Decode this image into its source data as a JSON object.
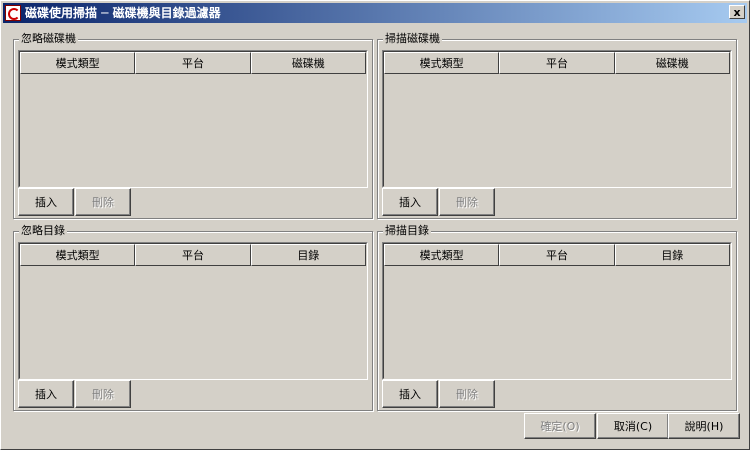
{
  "window": {
    "title": "磁碟使用掃描 ─ 磁碟機與目錄過濾器",
    "close_glyph": "x"
  },
  "panels": [
    {
      "label": "忽略磁碟機",
      "columns": [
        "模式類型",
        "平台",
        "磁碟機"
      ],
      "rows": [],
      "insert_label": "插入",
      "delete_label": "刪除"
    },
    {
      "label": "掃描磁碟機",
      "columns": [
        "模式類型",
        "平台",
        "磁碟機"
      ],
      "rows": [],
      "insert_label": "插入",
      "delete_label": "刪除"
    },
    {
      "label": "忽略目錄",
      "columns": [
        "模式類型",
        "平台",
        "目錄"
      ],
      "rows": [],
      "insert_label": "插入",
      "delete_label": "刪除"
    },
    {
      "label": "掃描目錄",
      "columns": [
        "模式類型",
        "平台",
        "目錄"
      ],
      "rows": [],
      "insert_label": "插入",
      "delete_label": "刪除"
    }
  ],
  "footer": {
    "ok_label": "確定(O)",
    "cancel_label": "取消(C)",
    "help_label": "說明(H)"
  }
}
